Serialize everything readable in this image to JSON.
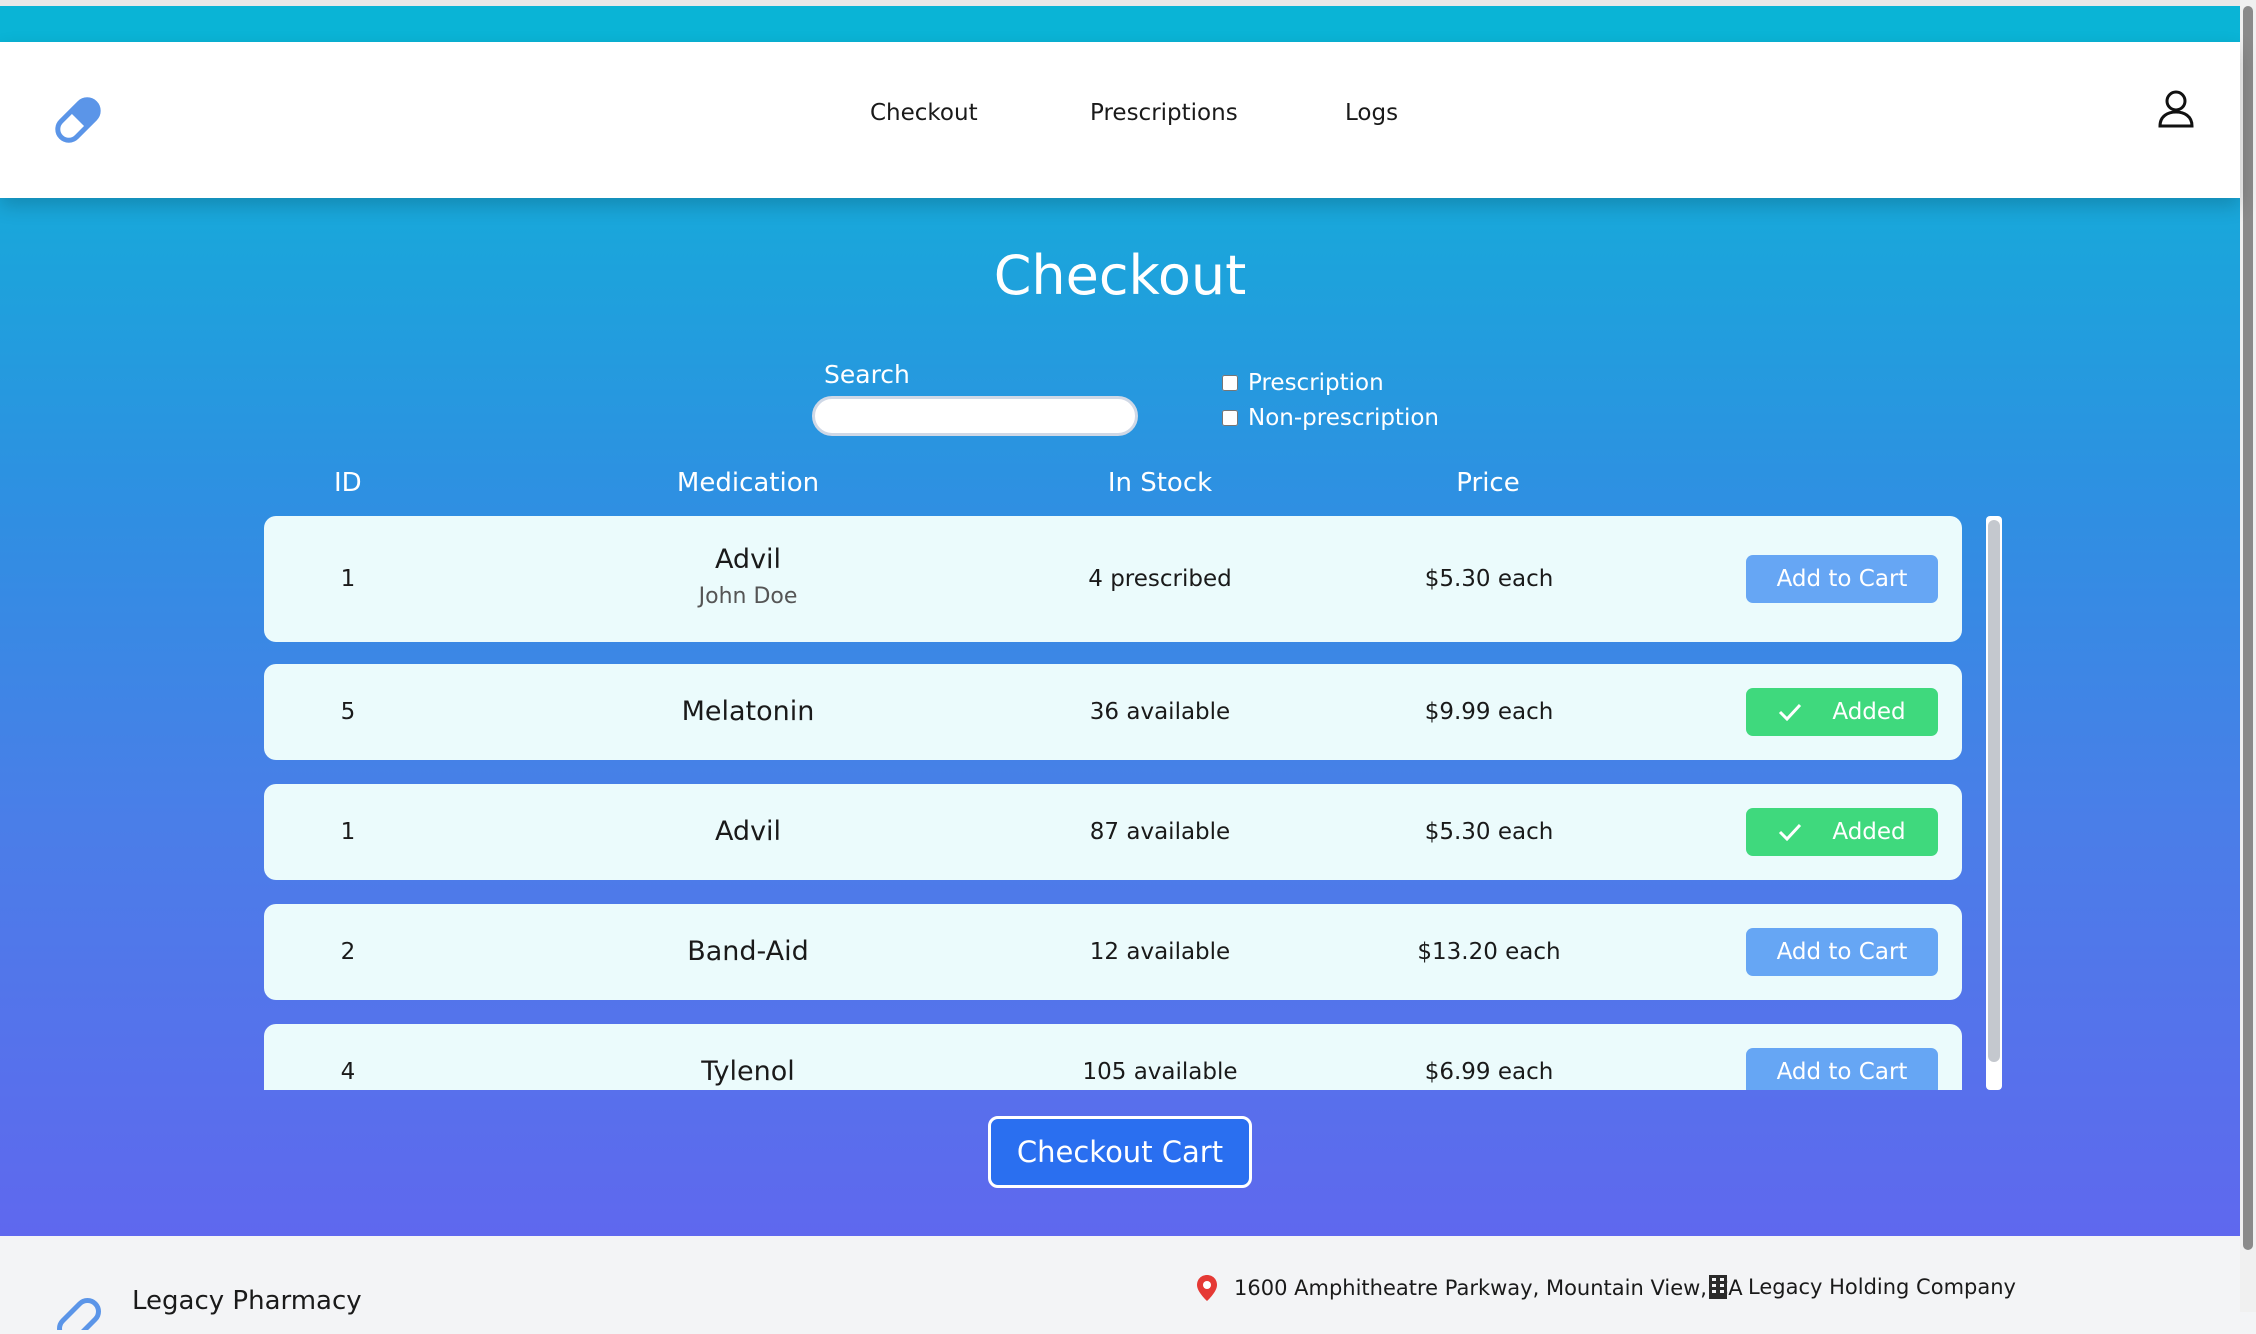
{
  "nav": {
    "links": [
      "Checkout",
      "Prescriptions",
      "Logs"
    ]
  },
  "page": {
    "title": "Checkout"
  },
  "search": {
    "label": "Search",
    "value": ""
  },
  "filters": [
    {
      "label": "Prescription",
      "checked": false
    },
    {
      "label": "Non-prescription",
      "checked": false
    }
  ],
  "columns": [
    "ID",
    "Medication",
    "In Stock",
    "Price"
  ],
  "rows": [
    {
      "id": "1",
      "medication": "Advil",
      "patient": "John Doe",
      "stock": "4 prescribed",
      "price": "$5.30 each",
      "action": "Add to Cart",
      "added": false
    },
    {
      "id": "5",
      "medication": "Melatonin",
      "patient": "",
      "stock": "36 available",
      "price": "$9.99 each",
      "action": "Added",
      "added": true
    },
    {
      "id": "1",
      "medication": "Advil",
      "patient": "",
      "stock": "87 available",
      "price": "$5.30 each",
      "action": "Added",
      "added": true
    },
    {
      "id": "2",
      "medication": "Band-Aid",
      "patient": "",
      "stock": "12 available",
      "price": "$13.20 each",
      "action": "Add to Cart",
      "added": false
    },
    {
      "id": "4",
      "medication": "Tylenol",
      "patient": "",
      "stock": "105 available",
      "price": "$6.99 each",
      "action": "Add to Cart",
      "added": false
    }
  ],
  "checkout_button": "Checkout Cart",
  "footer": {
    "name": "Legacy Pharmacy",
    "address": "1600 Amphitheatre Parkway, Mountain View, CA",
    "company": "Legacy Holding Company"
  },
  "colors": {
    "accent": "#0ab4d6",
    "add_button": "#66a6f4",
    "added_button": "#3fd97d",
    "checkout_button": "#2a6ff0"
  },
  "icons": [
    "pill-logo-icon",
    "user-icon",
    "check-icon",
    "location-pin-icon",
    "building-icon"
  ]
}
